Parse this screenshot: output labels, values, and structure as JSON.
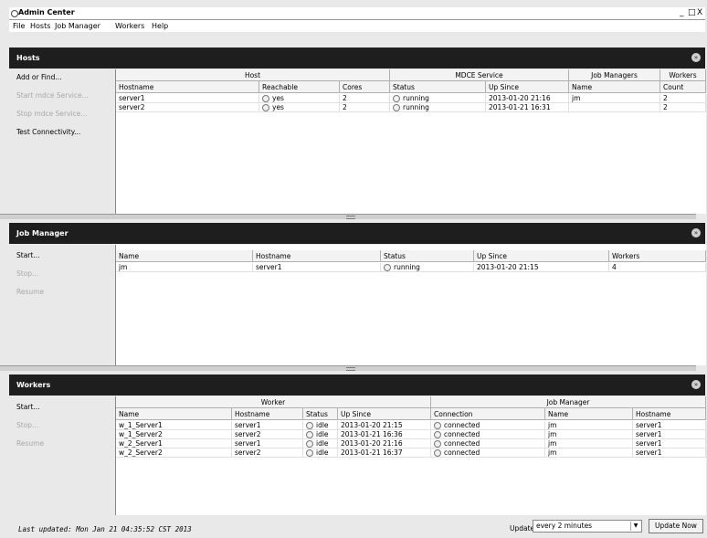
{
  "window": {
    "title": "Admin Center",
    "controls": [
      "_",
      "□",
      "X"
    ]
  },
  "menu": [
    "File",
    "Hosts",
    "Job Manager",
    "Workers",
    "Help"
  ],
  "hosts": {
    "title": "Hosts",
    "actions": [
      {
        "label": "Add or Find...",
        "enabled": true
      },
      {
        "label": "Start mdce Service...",
        "enabled": false
      },
      {
        "label": "Stop mdce Service...",
        "enabled": false
      },
      {
        "label": "Test Connectivity...",
        "enabled": true
      }
    ],
    "groups": [
      "Host",
      "MDCE Service",
      "Job Managers",
      "Workers"
    ],
    "columns": [
      "Hostname",
      "Reachable",
      "Cores",
      "Status",
      "Up Since",
      "Name",
      "Count"
    ],
    "rows": [
      [
        "server1",
        "yes",
        "2",
        "running",
        "2013-01-20 21:16",
        "jm",
        "2"
      ],
      [
        "server2",
        "yes",
        "2",
        "running",
        "2013-01-21 16:31",
        "",
        "2"
      ]
    ]
  },
  "jobmanager": {
    "title": "Job Manager",
    "actions": [
      {
        "label": "Start...",
        "enabled": true
      },
      {
        "label": "Stop...",
        "enabled": false
      },
      {
        "label": "Resume",
        "enabled": false
      }
    ],
    "columns": [
      "Name",
      "Hostname",
      "Status",
      "Up Since",
      "Workers"
    ],
    "rows": [
      [
        "jm",
        "server1",
        "running",
        "2013-01-20 21:15",
        "4"
      ]
    ]
  },
  "workers": {
    "title": "Workers",
    "actions": [
      {
        "label": "Start...",
        "enabled": true
      },
      {
        "label": "Stop...",
        "enabled": false
      },
      {
        "label": "Resume",
        "enabled": false
      }
    ],
    "groups": [
      "Worker",
      "Job Manager"
    ],
    "columns": [
      "Name",
      "Hostname",
      "Status",
      "Up Since",
      "Connection",
      "Name",
      "Hostname"
    ],
    "rows": [
      [
        "w_1_Server1",
        "server1",
        "idle",
        "2013-01-20 21:15",
        "connected",
        "jm",
        "server1"
      ],
      [
        "w_1_Server2",
        "server2",
        "idle",
        "2013-01-21 16:36",
        "connected",
        "jm",
        "server1"
      ],
      [
        "w_2_Server1",
        "server1",
        "idle",
        "2013-01-20 21:16",
        "connected",
        "jm",
        "server1"
      ],
      [
        "w_2_Server2",
        "server2",
        "idle",
        "2013-01-21 16:37",
        "connected",
        "jm",
        "server1"
      ]
    ]
  },
  "status": {
    "last_updated": "Last updated: Mon Jan 21 04:35:52 CST 2013",
    "update_label": "Update",
    "update_interval": "every 2 minutes",
    "update_now": "Update Now"
  }
}
